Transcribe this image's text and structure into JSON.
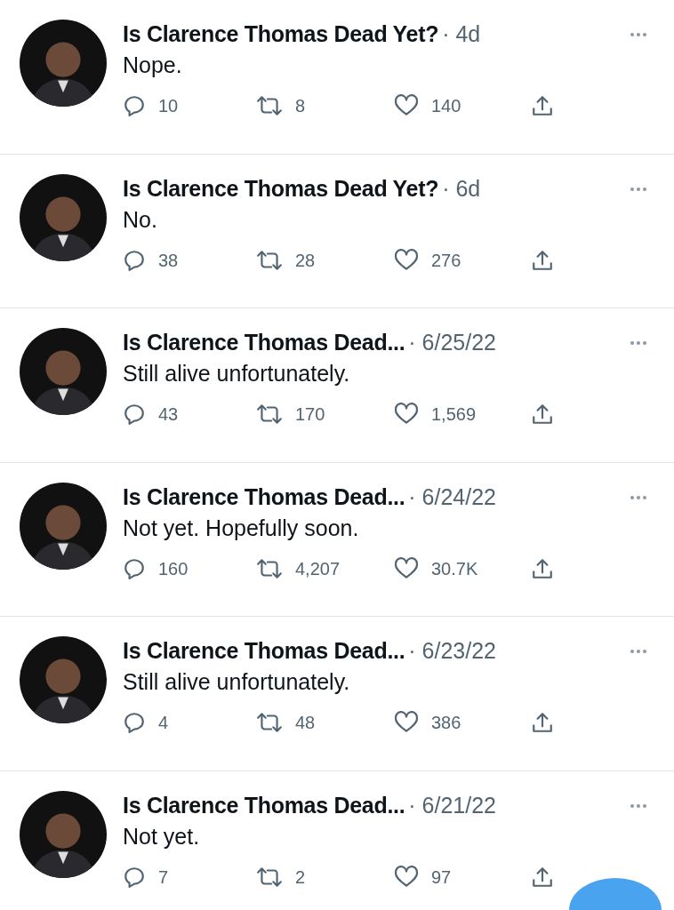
{
  "tweets": [
    {
      "name": "Is Clarence Thomas Dead Yet?",
      "time": "· 4d",
      "text": "Nope.",
      "replies": "10",
      "retweets": "8",
      "likes": "140"
    },
    {
      "name": "Is Clarence Thomas Dead Yet?",
      "time": "· 6d",
      "text": "No.",
      "replies": "38",
      "retweets": "28",
      "likes": "276"
    },
    {
      "name": "Is Clarence Thomas Dead...",
      "time": "· 6/25/22",
      "text": "Still alive unfortunately.",
      "replies": "43",
      "retweets": "170",
      "likes": "1,569"
    },
    {
      "name": "Is Clarence Thomas Dead...",
      "time": "· 6/24/22",
      "text": "Not yet. Hopefully soon.",
      "replies": "160",
      "retweets": "4,207",
      "likes": "30.7K"
    },
    {
      "name": "Is Clarence Thomas Dead...",
      "time": "· 6/23/22",
      "text": "Still alive unfortunately.",
      "replies": "4",
      "retweets": "48",
      "likes": "386"
    },
    {
      "name": "Is Clarence Thomas Dead...",
      "time": "· 6/21/22",
      "text": "Not yet.",
      "replies": "7",
      "retweets": "2",
      "likes": "97"
    }
  ]
}
